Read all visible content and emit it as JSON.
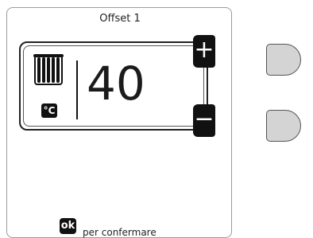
{
  "screen": {
    "title": "Offset 1",
    "value": "40",
    "unit_badge": "°C",
    "confirm_badge": "ok",
    "confirm_text": "per confermare"
  },
  "buttons": {
    "increase_label": "+",
    "decrease_label": "−"
  },
  "icons": {
    "heating": "radiator-icon"
  },
  "colors": {
    "hardware_button": "#d4d4d4",
    "badge": "#111111"
  }
}
